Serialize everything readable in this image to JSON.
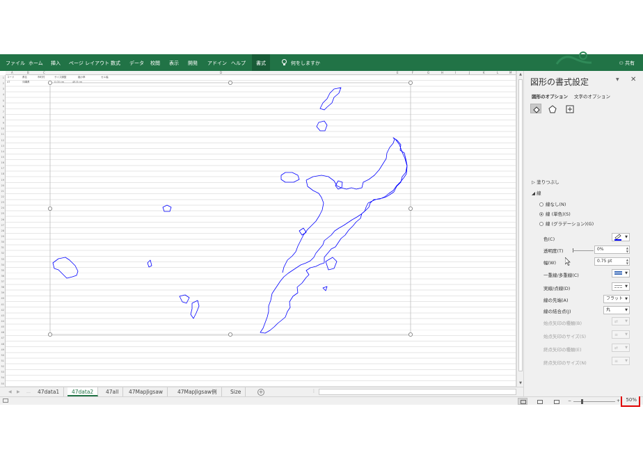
{
  "ribbon": {
    "tabs": [
      "ファイル",
      "ホーム",
      "挿入",
      "ページ レイアウト",
      "数式",
      "データ",
      "校閲",
      "表示",
      "開発",
      "アドイン",
      "ヘルプ",
      "書式"
    ],
    "active_tab": "書式",
    "tell_me": "何をしますか",
    "share": "共有",
    "color": "#217346"
  },
  "sheet": {
    "columns": [
      "A",
      "B",
      "C",
      "D",
      "E",
      "F",
      "G",
      "H",
      "I",
      "J",
      "K",
      "L",
      "M"
    ],
    "rows": [
      "1",
      "2",
      "3",
      "4",
      "5",
      "6",
      "7",
      "8",
      "9",
      "10",
      "11",
      "12",
      "13",
      "14",
      "15",
      "16",
      "17",
      "18",
      "19",
      "20",
      "21",
      "22",
      "23",
      "24",
      "25",
      "26",
      "27",
      "28",
      "29",
      "30",
      "31",
      "32",
      "33",
      "34",
      "35",
      "36",
      "37",
      "38",
      "39",
      "40",
      "41",
      "42",
      "43",
      "44",
      "45",
      "46",
      "47",
      "48",
      "49",
      "50",
      "51",
      "52",
      "53",
      "54",
      "55"
    ],
    "cells": {
      "a1": "コード",
      "b1": "県名",
      "c1": "市町村",
      "d1": "サイズ調整",
      "e1": "縮小率",
      "f1": "セル幅",
      "a2": "47",
      "b2": "沖縄県",
      "d2": "0.00 cm",
      "e2": "48.8 cm"
    }
  },
  "sheet_tabs": [
    "47data1",
    "47data2",
    "47all",
    "47MapJigsaw",
    "47MapJigsaw例",
    "Size"
  ],
  "active_sheet": "47data2",
  "status": {
    "zoom": "50%",
    "zoom_level_percent": 50
  },
  "pane": {
    "title": "図形の書式設定",
    "subtabs": [
      "図形のオプション",
      "文字のオプション"
    ],
    "sections": {
      "fill": "塗りつぶし",
      "line": "線"
    },
    "line_options": [
      "線なし(N)",
      "線 (単色)(S)",
      "線 (グラデーション)(G)"
    ],
    "selected_line_option": "線 (単色)(S)",
    "labels": {
      "color": "色(C)",
      "transparency": "透明度(T)",
      "width": "幅(W)",
      "compound": "一重線/多重線(C)",
      "dash": "実線/点線(D)",
      "cap": "線の先端(A)",
      "join": "線の結合点(J)",
      "begin_arrow_type": "始点矢印の種類(B)",
      "begin_arrow_size": "始点矢印のサイズ(S)",
      "end_arrow_type": "終点矢印の種類(E)",
      "end_arrow_size": "終点矢印のサイズ(N)"
    },
    "values": {
      "transparency": "0%",
      "width": "0.75 pt",
      "cap": "フラット",
      "join": "丸"
    },
    "line_color": "#0000ff"
  }
}
